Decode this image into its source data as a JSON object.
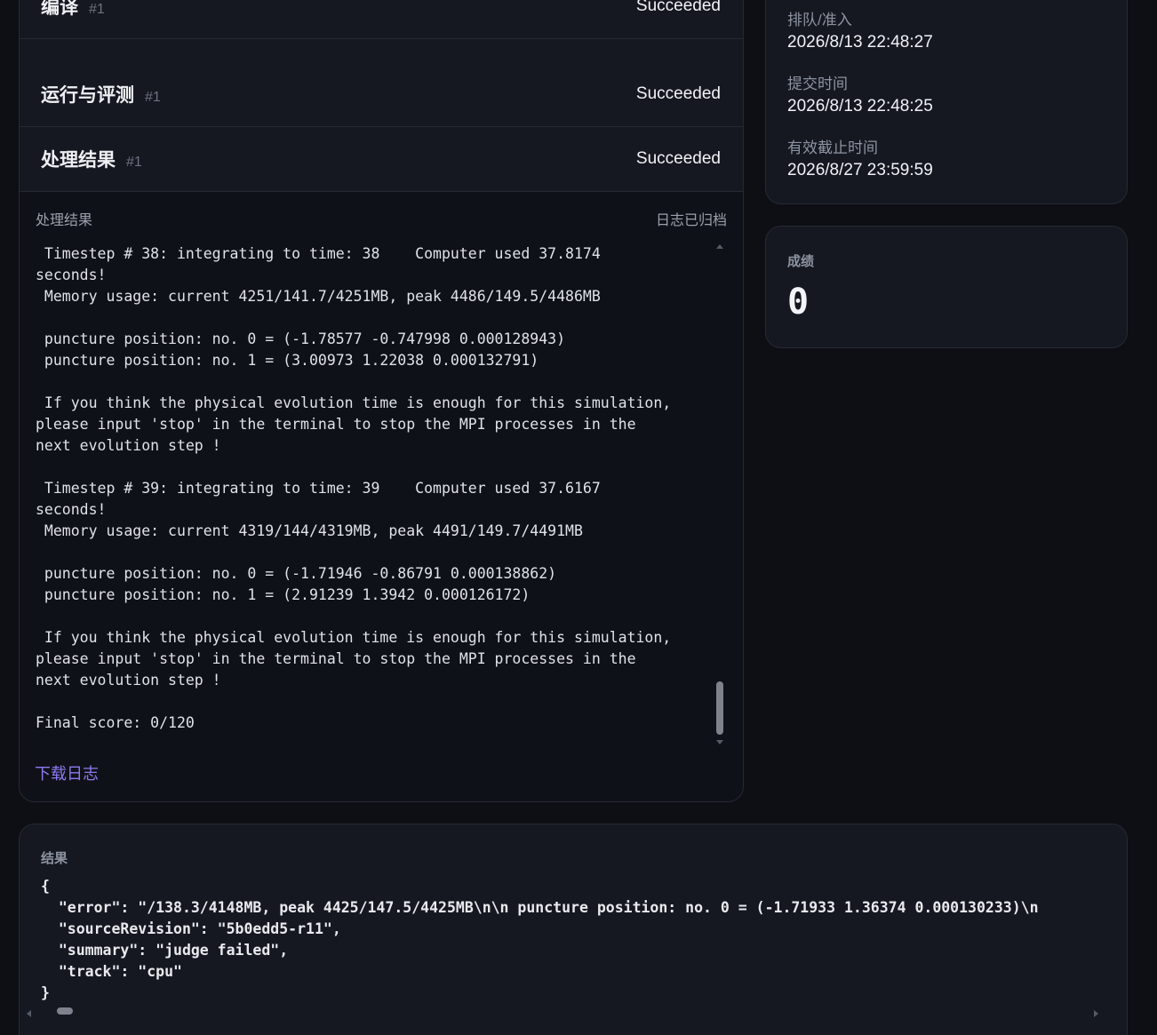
{
  "stages": [
    {
      "name": "编译",
      "num": "#1",
      "status": "Succeeded"
    },
    {
      "name": "运行与评测",
      "num": "#1",
      "status": "Succeeded"
    },
    {
      "name": "处理结果",
      "num": "#1",
      "status": "Succeeded"
    }
  ],
  "log": {
    "title": "处理结果",
    "archived": "日志已归档",
    "lines": [
      " Timestep # 38: integrating to time: 38    Computer used 37.8174",
      "seconds!",
      " Memory usage: current 4251/141.7/4251MB, peak 4486/149.5/4486MB",
      "",
      " puncture position: no. 0 = (-1.78577 -0.747998 0.000128943)",
      " puncture position: no. 1 = (3.00973 1.22038 0.000132791)",
      "",
      " If you think the physical evolution time is enough for this simulation,",
      "please input 'stop' in the terminal to stop the MPI processes in the",
      "next evolution step !",
      "",
      " Timestep # 39: integrating to time: 39    Computer used 37.6167",
      "seconds!",
      " Memory usage: current 4319/144/4319MB, peak 4491/149.7/4491MB",
      "",
      " puncture position: no. 0 = (-1.71946 -0.86791 0.000138862)",
      " puncture position: no. 1 = (2.91239 1.3942 0.000126172)",
      "",
      " If you think the physical evolution time is enough for this simulation,",
      "please input 'stop' in the terminal to stop the MPI processes in the",
      "next evolution step !",
      "",
      "Final score: 0/120"
    ],
    "download": "下载日志"
  },
  "times": [
    {
      "label": "排队/准入",
      "value": "2026/8/13 22:48:27"
    },
    {
      "label": "提交时间",
      "value": "2026/8/13 22:48:25"
    },
    {
      "label": "有效截止时间",
      "value": "2026/8/27 23:59:59"
    }
  ],
  "score": {
    "label": "成绩",
    "value": "0"
  },
  "result": {
    "label": "结果",
    "json_lines": [
      "{",
      "  \"error\": \"/138.3/4148MB, peak 4425/147.5/4425MB\\n\\n puncture position: no. 0 = (-1.71933 1.36374 0.000130233)\\n",
      "  \"sourceRevision\": \"5b0edd5-r11\",",
      "  \"summary\": \"judge failed\",",
      "  \"track\": \"cpu\"",
      "}"
    ]
  }
}
